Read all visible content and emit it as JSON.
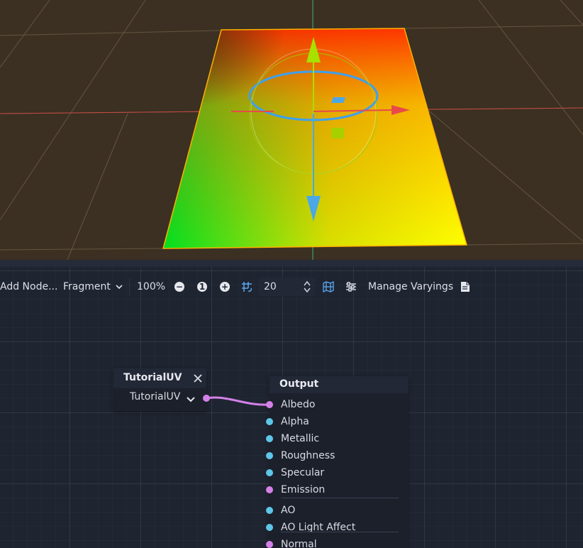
{
  "toolbar": {
    "add_node_label": "Add Node...",
    "mode_select": "Fragment",
    "zoom_label": "100%",
    "zoom_out_icon": "minus-circle-icon",
    "zoom_reset_label": "1",
    "zoom_in_icon": "plus-circle-icon",
    "snap_icon": "grid-snap-icon",
    "snap_value": "20",
    "minimap_icon": "minimap-icon",
    "arrange_icon": "arrange-nodes-icon",
    "manage_varyings_label": "Manage Varyings",
    "shader_code_icon": "document-icon"
  },
  "nodes": {
    "tutorial_uv": {
      "title": "TutorialUV",
      "close_icon": "close-icon",
      "output_label": "TutorialUV",
      "expand_icon": "chevron-down-icon"
    },
    "output": {
      "title": "Output",
      "ports": [
        {
          "label": "Albedo",
          "color": "#d381e8",
          "connected": true
        },
        {
          "label": "Alpha",
          "color": "#5ec6e8"
        },
        {
          "label": "Metallic",
          "color": "#5ec6e8"
        },
        {
          "label": "Roughness",
          "color": "#5ec6e8"
        },
        {
          "label": "Specular",
          "color": "#5ec6e8"
        },
        {
          "label": "Emission",
          "color": "#d381e8"
        },
        {
          "label": "AO",
          "color": "#5ec6e8"
        },
        {
          "label": "AO Light Affect",
          "color": "#5ec6e8"
        },
        {
          "label": "Normal",
          "color": "#d381e8"
        }
      ]
    }
  },
  "colors": {
    "viewport_bg": "#3b3022",
    "graph_bg": "#1f2431",
    "connection": "#d381e8",
    "gizmo_blue": "#4aa8e8",
    "gizmo_red": "#e84a4a",
    "gizmo_green": "#a8e000"
  }
}
